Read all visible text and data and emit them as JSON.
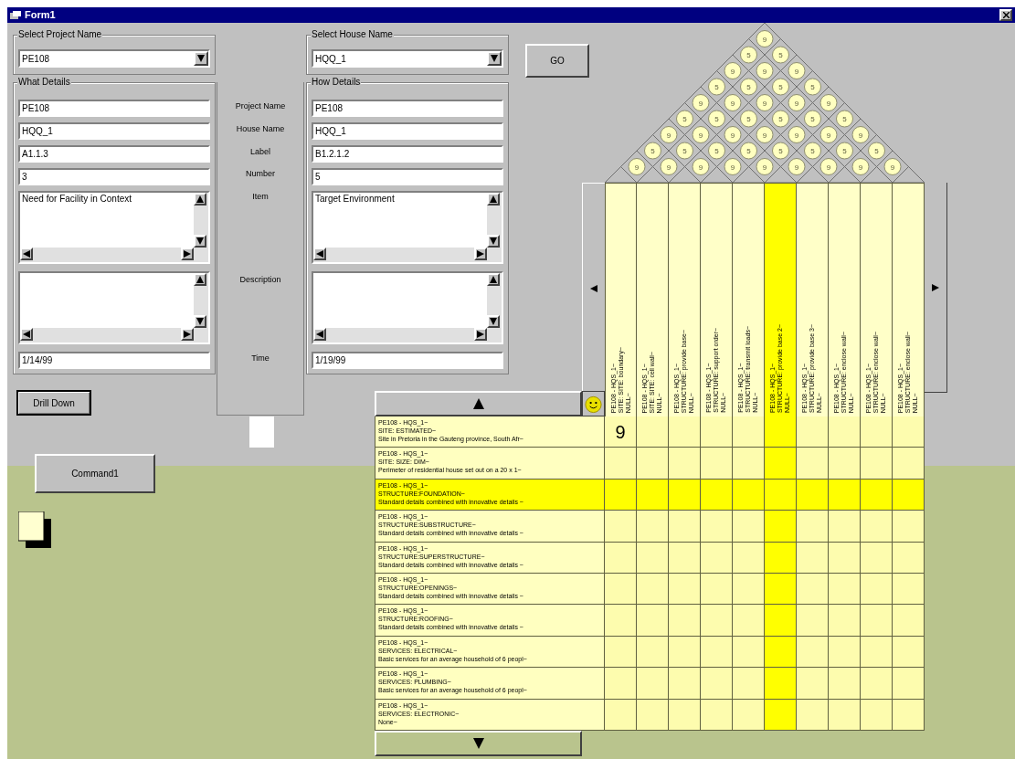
{
  "window": {
    "title": "Form1"
  },
  "project_select": {
    "label": "Select Project Name",
    "value": "PE108"
  },
  "house_select": {
    "label": "Select House Name",
    "value": "HQQ_1"
  },
  "go_button": "GO",
  "field_labels": [
    "Project Name",
    "House Name",
    "Label",
    "Number",
    "Item",
    "Description",
    "Time"
  ],
  "what_details": {
    "title": "What Details",
    "project_name": "PE108",
    "house_name": "HQQ_1",
    "label": "A1.1.3",
    "number": "3",
    "item": "Need for Facility in Context",
    "time": "1/14/99"
  },
  "how_details": {
    "title": "How Details",
    "project_name": "PE108",
    "house_name": "HQQ_1",
    "label": "B1.2.1.2",
    "number": "5",
    "item": "Target Environment",
    "time": "1/19/99"
  },
  "drill_down_button": "Drill Down",
  "command_button": "Command1",
  "roof": [
    [
      "9"
    ],
    [
      "5",
      "5"
    ],
    [
      "9",
      "9",
      "9"
    ],
    [
      "5",
      "5",
      "5",
      "5"
    ],
    [
      "9",
      "9",
      "9",
      "9",
      "9"
    ],
    [
      "5",
      "5",
      "5",
      "5",
      "5",
      "5"
    ],
    [
      "9",
      "9",
      "9",
      "9",
      "9",
      "9",
      "9"
    ],
    [
      "5",
      "5",
      "5",
      "5",
      "5",
      "5",
      "5",
      "5"
    ],
    [
      "9",
      "9",
      "9",
      "9",
      "9",
      "9",
      "9",
      "9",
      "9"
    ]
  ],
  "columns": [
    {
      "lines": [
        "PE108 - HQS_1~",
        "SITE: SITE: boundary~",
        "NULL~"
      ],
      "selected": false
    },
    {
      "lines": [
        "PE108 - HQS_1~",
        "SITE: SITE: cell wall~",
        "NULL~"
      ],
      "selected": false
    },
    {
      "lines": [
        "PE108 - HQS_1~",
        "STRUCTURE: provide base~",
        "NULL~"
      ],
      "selected": false
    },
    {
      "lines": [
        "PE108 - HQS_1~",
        "STRUCTURE: support order~",
        "NULL~"
      ],
      "selected": false
    },
    {
      "lines": [
        "PE108 - HQS_1~",
        "STRUCTURE: transmit loads~",
        "NULL~"
      ],
      "selected": false
    },
    {
      "lines": [
        "PE108 - HQS_1~",
        "STRUCTURE: provide base 2~",
        "NULL~"
      ],
      "selected": true
    },
    {
      "lines": [
        "PE108 - HQS_1~",
        "STRUCTURE: provide base 3~",
        "NULL~"
      ],
      "selected": false
    },
    {
      "lines": [
        "PE108 - HQS_1~",
        "STRUCTURE: enclose wall~",
        "NULL~"
      ],
      "selected": false
    },
    {
      "lines": [
        "PE108 - HQS_1~",
        "STRUCTURE: enclose wall~",
        "NULL~"
      ],
      "selected": false
    },
    {
      "lines": [
        "PE108 - HQS_1~",
        "STRUCTURE: enclose wall~",
        "NULL~"
      ],
      "selected": false
    }
  ],
  "rows": [
    {
      "lines": [
        "PE108 - HQS_1~",
        "SITE: ESTIMATED~",
        "Site in Pretoria in the Gauteng province, South Afr~"
      ],
      "selected": false,
      "cells": [
        {
          "kind": "rating",
          "value": "9"
        },
        {
          "kind": "blank"
        },
        {
          "kind": "blank"
        },
        {
          "kind": "blank"
        },
        {
          "kind": "blank"
        },
        {
          "kind": "blank"
        },
        {
          "kind": "blank"
        },
        {
          "kind": "blank"
        },
        {
          "kind": "blank"
        },
        {
          "kind": "blank"
        }
      ]
    },
    {
      "lines": [
        "PE108 - HQS_1~",
        "SITE: SIZE: DIM~",
        "Perimeter of residential house set out on a 20 x 1~"
      ],
      "selected": false
    },
    {
      "lines": [
        "PE108 - HQS_1~",
        "STRUCTURE:FOUNDATION~",
        "Standard details combined with innovative details ~"
      ],
      "selected": true
    },
    {
      "lines": [
        "PE108 - HQS_1~",
        "STRUCTURE:SUBSTRUCTURE~",
        "Standard details combined with innovative details ~"
      ],
      "selected": false
    },
    {
      "lines": [
        "PE108 - HQS_1~",
        "STRUCTURE:SUPERSTRUCTURE~",
        "Standard details combined with innovative details ~"
      ],
      "selected": false
    },
    {
      "lines": [
        "PE108 - HQS_1~",
        "STRUCTURE:OPENINGS~",
        "Standard details combined with innovative details ~"
      ],
      "selected": false
    },
    {
      "lines": [
        "PE108 - HQS_1~",
        "STRUCTURE:ROOFING~",
        "Standard details combined with innovative details ~"
      ],
      "selected": false
    },
    {
      "lines": [
        "PE108 - HQS_1~",
        "SERVICES: ELECTRICAL~",
        "Basic services for an average household of 6 peopl~"
      ],
      "selected": false
    },
    {
      "lines": [
        "PE108 - HQS_1~",
        "SERVICES: PLUMBING~",
        "Basic services for an average household of 6 peopl~"
      ],
      "selected": false
    },
    {
      "lines": [
        "PE108 - HQS_1~",
        "SERVICES: ELECTRONIC~",
        "None~"
      ],
      "selected": false
    }
  ]
}
